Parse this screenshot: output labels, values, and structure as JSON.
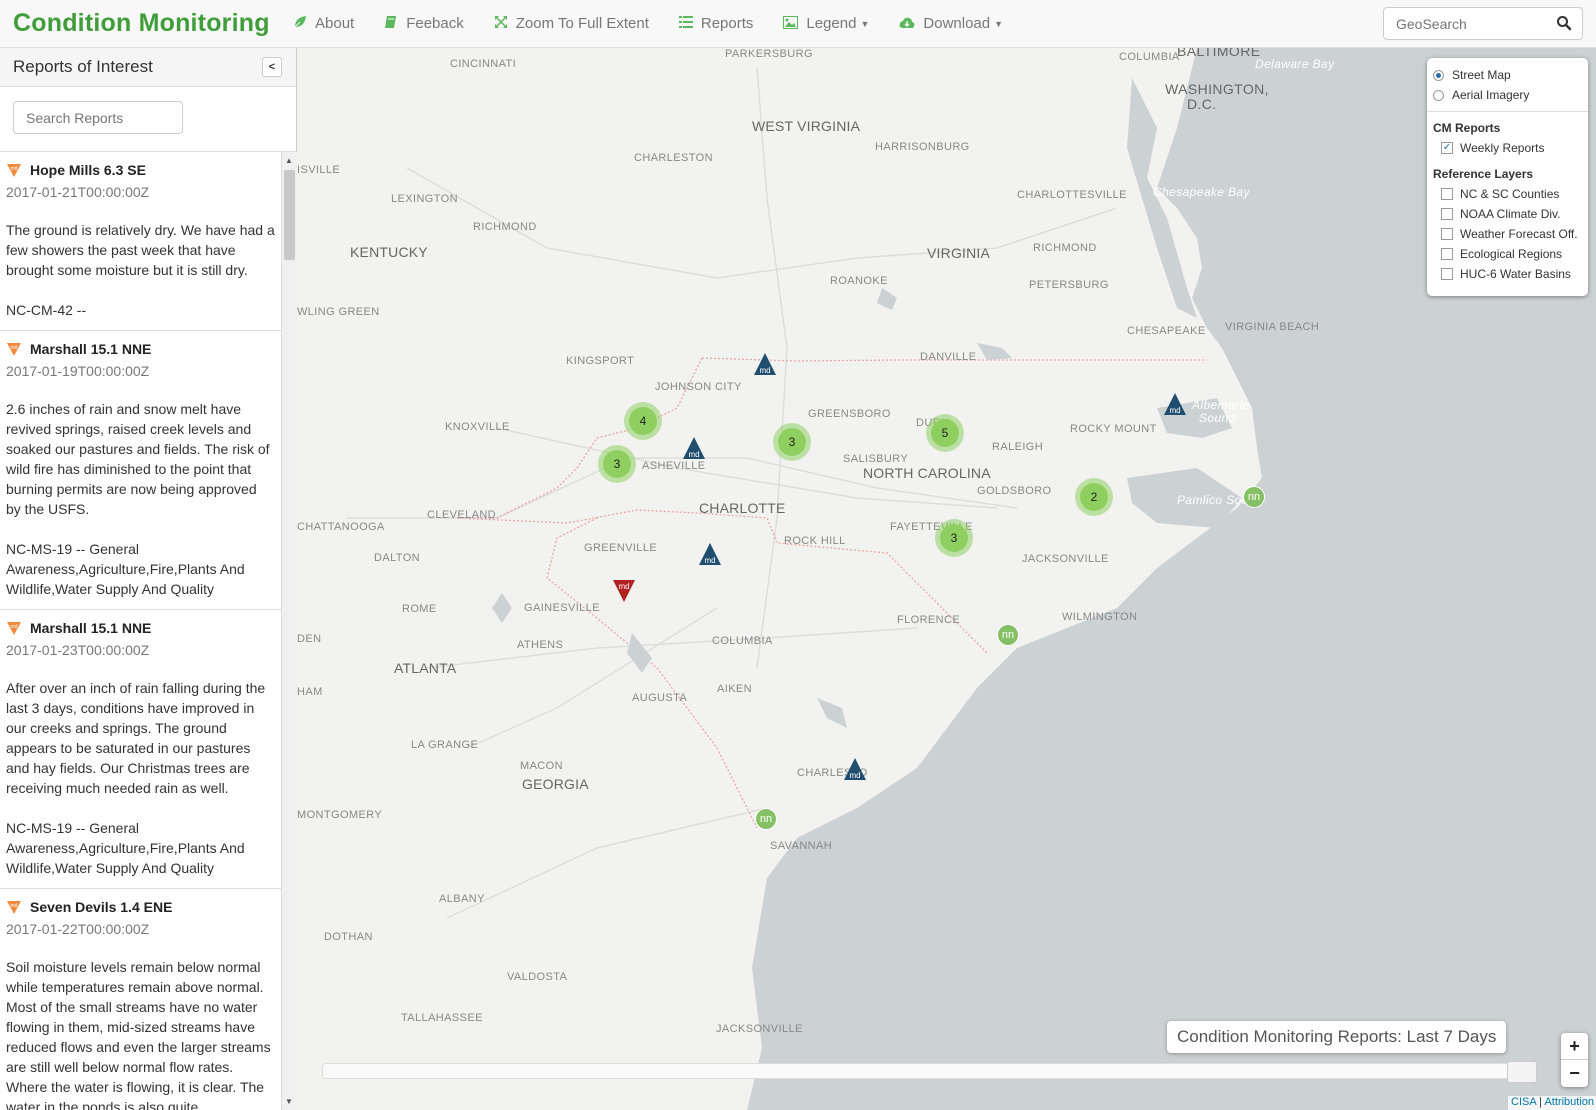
{
  "navbar": {
    "brand": "Condition Monitoring",
    "items": [
      {
        "label": "About",
        "icon": "leaf-icon"
      },
      {
        "label": "Feeback",
        "icon": "book-icon"
      },
      {
        "label": "Zoom To Full Extent",
        "icon": "fullscreen-icon"
      },
      {
        "label": "Reports",
        "icon": "list-icon"
      },
      {
        "label": "Legend",
        "icon": "picture-icon"
      },
      {
        "label": "Download",
        "icon": "cloud-download-icon"
      }
    ],
    "geosearch_placeholder": "GeoSearch"
  },
  "sidebar": {
    "title": "Reports of Interest",
    "search_placeholder": "Search Reports",
    "reports": [
      {
        "name": "Hope Mills 6.3 SE",
        "date": "2017-01-21T00:00:00Z",
        "text": "The ground is relatively dry. We have had a few showers the past week that have brought some moisture but it is still dry.",
        "tags": "NC-CM-42 --"
      },
      {
        "name": "Marshall 15.1 NNE",
        "date": "2017-01-19T00:00:00Z",
        "text": "2.6 inches of rain and snow melt have revived springs, raised creek levels and soaked our pastures and fields. The risk of wild fire has diminished to the point that burning permits are now being approved by the USFS.",
        "tags": "NC-MS-19 -- General Awareness,Agriculture,Fire,Plants And Wildlife,Water Supply And Quality"
      },
      {
        "name": "Marshall 15.1 NNE",
        "date": "2017-01-23T00:00:00Z",
        "text": "After over an inch of rain falling during the last 3 days, conditions have improved in our creeks and springs. The ground appears to be saturated in our pastures and hay fields. Our Christmas trees are receiving much needed rain as well.",
        "tags": "NC-MS-19 -- General Awareness,Agriculture,Fire,Plants And Wildlife,Water Supply And Quality"
      },
      {
        "name": "Seven Devils 1.4 ENE",
        "date": "2017-01-22T00:00:00Z",
        "text": "Soil moisture levels remain below normal while temperatures remain above normal. Most of the small streams have no water flowing in them, mid-sized streams have reduced flows and even the larger streams are still well below normal flow rates. Where the water is flowing, it is clear. The water in the ponds is also quite",
        "tags": ""
      }
    ]
  },
  "map": {
    "labels": {
      "cincinnati": "CINCINNATI",
      "parkersburg": "PARKERSBURG",
      "baltimore": "BALTIMORE",
      "washington": "WASHINGTON,",
      "dc": "D.C.",
      "delaware_bay": "Delaware Bay",
      "columbia_md": "COLUMBIA",
      "west_virginia": "WEST VIRGINIA",
      "charleston_wv": "CHARLESTON",
      "harrisonburg": "HARRISONBURG",
      "louisville": "ISVILLE",
      "lexington": "LEXINGTON",
      "richmond_ky": "RICHMOND",
      "charlottesville": "CHARLOTTESVILLE",
      "chesapeake_bay": "Chesapeake Bay",
      "kentucky": "KENTUCKY",
      "virginia": "VIRGINIA",
      "richmond_va": "RICHMOND",
      "roanoke": "ROANOKE",
      "petersburg": "PETERSBURG",
      "bowling_green": "WLING GREEN",
      "chesapeake": "CHESAPEAKE",
      "virginia_beach": "VIRGINIA BEACH",
      "danville": "DANVILLE",
      "kingsport": "KINGSPORT",
      "johnson_city": "JOHNSON CITY",
      "albemarle_sound": "Albemarle",
      "albemarle_sound2": "Sound",
      "greensboro": "GREENSBORO",
      "knoxville": "KNOXVILLE",
      "durham": "DURH",
      "raleigh": "RALEIGH",
      "rocky_mount": "ROCKY MOUNT",
      "asheville": "ASHEVILLE",
      "salisbury": "SALISBURY",
      "north_carolina": "NORTH CAROLINA",
      "goldsboro": "GOLDSBORO",
      "pamlico_sound": "Pamlico Sound",
      "charlotte": "CHARLOTTE",
      "chattanooga": "CHATTANOOGA",
      "cleveland": "CLEVELAND",
      "fayetteville": "FAYETTEVILLE",
      "rock_hill": "ROCK HILL",
      "greenville": "GREENVILLE",
      "jacksonville_nc": "JACKSONVILLE",
      "dalton": "DALTON",
      "rome": "ROME",
      "gainesville": "GAINESVILLE",
      "florence": "FLORENCE",
      "wilmington": "WILMINGTON",
      "athens": "ATHENS",
      "columbia": "COLUMBIA",
      "atlanta": "ATLANTA",
      "den": "DEN",
      "ham": "HAM",
      "augusta": "AUGUSTA",
      "aiken": "AIKEN",
      "la_grange": "LA GRANGE",
      "macon": "MACON",
      "georgia": "GEORGIA",
      "charleston_sc": "CHARLESTO",
      "montgomery": "MONTGOMERY",
      "savannah": "SAVANNAH",
      "albany": "ALBANY",
      "dothan": "DOTHAN",
      "valdosta": "VALDOSTA",
      "tallahassee": "TALLAHASSEE",
      "jacksonville_fl": "JACKSONVILLE"
    },
    "clusters": [
      "4",
      "3",
      "3",
      "5",
      "2",
      "3"
    ],
    "markers": {
      "md": "md",
      "nn": "nn"
    }
  },
  "layers": {
    "base": [
      "Street Map",
      "Aerial Imagery"
    ],
    "cm_title": "CM Reports",
    "cm_items": [
      "Weekly Reports"
    ],
    "ref_title": "Reference Layers",
    "ref_items": [
      "NC & SC Counties",
      "NOAA Climate Div.",
      "Weather Forecast Off.",
      "Ecological Regions",
      "HUC-6 Water Basins"
    ]
  },
  "timeline": {
    "label": "Condition Monitoring Reports: Last 7 Days"
  },
  "zoom": {
    "in": "+",
    "out": "−"
  },
  "attribution": {
    "cisa": "CISA",
    "sep": "|",
    "attr": "Attribution"
  },
  "colors": {
    "brand": "#3f9d3a",
    "cluster": "#8fcf5f",
    "md_marker": "#1f4e6e",
    "md_red": "#b22222",
    "nn": "#85c067",
    "ocean": "#ccd1d3"
  }
}
